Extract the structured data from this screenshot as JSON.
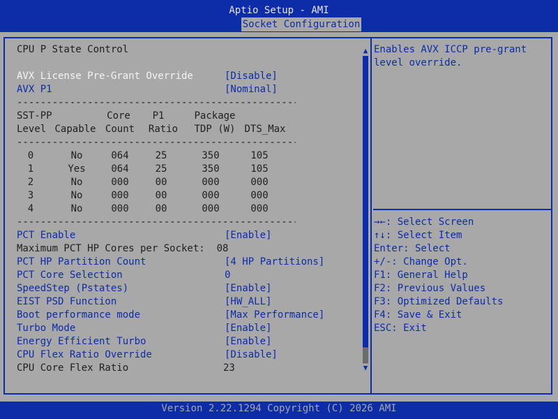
{
  "header": {
    "app_title": "Aptio Setup - AMI",
    "active_tab": "Socket Configuration"
  },
  "page": {
    "section_title": "CPU P State Control"
  },
  "settings_top": [
    {
      "label": "AVX License Pre-Grant Override",
      "value": "[Disable]"
    },
    {
      "label": "AVX P1",
      "value": "[Nominal]"
    }
  ],
  "table": {
    "separator": "--------------------------------------------------",
    "header_row1": [
      "SST-PP",
      "",
      "Core",
      "P1",
      "Package",
      ""
    ],
    "header_row2": [
      "Level",
      "Capable",
      "Count",
      "Ratio",
      "TDP (W)",
      "DTS_Max"
    ],
    "rows": [
      [
        "0",
        "No",
        "064",
        "25",
        "350",
        "105"
      ],
      [
        "1",
        "Yes",
        "064",
        "25",
        "350",
        "105"
      ],
      [
        "2",
        "No",
        "000",
        "00",
        "000",
        "000"
      ],
      [
        "3",
        "No",
        "000",
        "00",
        "000",
        "000"
      ],
      [
        "4",
        "No",
        "000",
        "00",
        "000",
        "000"
      ]
    ]
  },
  "settings": [
    {
      "label": "PCT Enable",
      "value": "[Enable]",
      "type": "option"
    },
    {
      "label": "Maximum PCT HP Cores per Socket:  08",
      "value": "",
      "type": "info"
    },
    {
      "label": "PCT HP Partition Count",
      "value": "[4 HP Partitions]",
      "type": "option"
    },
    {
      "label": "PCT Core Selection",
      "value": "0",
      "type": "number"
    },
    {
      "label": "SpeedStep (Pstates)",
      "value": "[Enable]",
      "type": "option"
    },
    {
      "label": "EIST PSD Function",
      "value": "[HW_ALL]",
      "type": "option"
    },
    {
      "label": "Boot performance mode",
      "value": "[Max Performance]",
      "type": "option"
    },
    {
      "label": "Turbo Mode",
      "value": "[Enable]",
      "type": "option"
    },
    {
      "label": "Energy Efficient Turbo",
      "value": "[Enable]",
      "type": "option"
    },
    {
      "label": "CPU Flex Ratio Override",
      "value": "[Disable]",
      "type": "option"
    },
    {
      "label": "CPU Core Flex Ratio",
      "value": "23",
      "type": "info"
    }
  ],
  "help": {
    "description": "Enables AVX ICCP pre-grant level override.",
    "keys": [
      "→←: Select Screen",
      "↑↓: Select Item",
      "Enter: Select",
      "+/-: Change Opt.",
      "F1: General Help",
      "F2: Previous Values",
      "F3: Optimized Defaults",
      "F4: Save & Exit",
      "ESC: Exit"
    ]
  },
  "footer": {
    "version": "Version 2.22.1294 Copyright (C) 2026 AMI"
  },
  "colors": {
    "bios_blue": "#0c2ca8",
    "background": "#a8a8a8",
    "highlight": "#f4f4f4"
  }
}
